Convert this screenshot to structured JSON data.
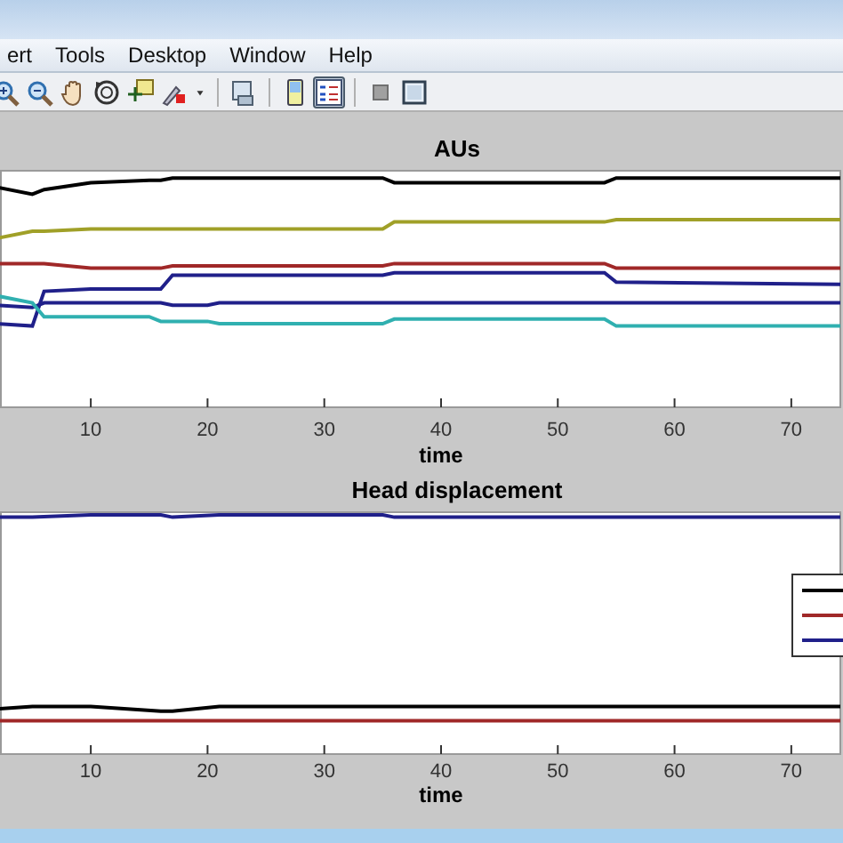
{
  "menu": [
    {
      "label": "ert"
    },
    {
      "label": "Tools"
    },
    {
      "label": "Desktop"
    },
    {
      "label": "Window"
    },
    {
      "label": "Help"
    }
  ],
  "toolbar": [
    {
      "kind": "zoom-in",
      "selected": false
    },
    {
      "kind": "zoom-out",
      "selected": false
    },
    {
      "kind": "pan",
      "selected": false
    },
    {
      "kind": "rotate",
      "selected": false
    },
    {
      "kind": "data-cursor",
      "selected": false
    },
    {
      "kind": "brush",
      "selected": false
    },
    {
      "kind": "caret"
    },
    {
      "kind": "separator"
    },
    {
      "kind": "link",
      "selected": false
    },
    {
      "kind": "separator"
    },
    {
      "kind": "colorbar",
      "selected": false
    },
    {
      "kind": "legend",
      "selected": true
    },
    {
      "kind": "separator"
    },
    {
      "kind": "hide",
      "selected": false
    },
    {
      "kind": "show",
      "selected": false
    }
  ],
  "charts": [
    {
      "title": "AUs",
      "xlabel": "time",
      "legend": false,
      "xticks": [
        "10",
        "20",
        "30",
        "40",
        "50",
        "60",
        "70"
      ],
      "lines": [
        {
          "color": "#000000"
        },
        {
          "color": "#a0a028"
        },
        {
          "color": "#a02828"
        },
        {
          "color": "#20208a"
        },
        {
          "color": "#20208a"
        },
        {
          "color": "#30b0b0"
        }
      ]
    },
    {
      "title": "Head displacement",
      "xlabel": "time",
      "legend": true,
      "xticks": [
        "10",
        "20",
        "30",
        "40",
        "50",
        "60",
        "70"
      ],
      "lines": [
        {
          "color": "#000000"
        },
        {
          "color": "#a02828"
        },
        {
          "color": "#20208a"
        }
      ]
    }
  ]
}
